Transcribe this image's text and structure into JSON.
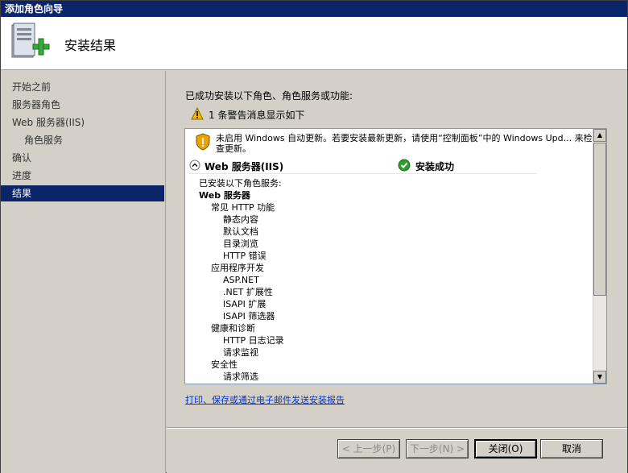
{
  "window": {
    "title": "添加角色向导"
  },
  "header": {
    "title": "安装结果",
    "icon": "server-add-icon"
  },
  "sidebar": {
    "items": [
      {
        "label": "开始之前",
        "active": false,
        "sub": false
      },
      {
        "label": "服务器角色",
        "active": false,
        "sub": false
      },
      {
        "label": "Web 服务器(IIS)",
        "active": false,
        "sub": false
      },
      {
        "label": "角色服务",
        "active": false,
        "sub": true
      },
      {
        "label": "确认",
        "active": false,
        "sub": false
      },
      {
        "label": "进度",
        "active": false,
        "sub": false
      },
      {
        "label": "结果",
        "active": true,
        "sub": false
      }
    ]
  },
  "main": {
    "intro": "已成功安装以下角色、角色服务或功能:",
    "warning_summary": "1 条警告消息显示如下",
    "report": {
      "windows_update_warning": "未启用 Windows 自动更新。若要安装最新更新，请使用“控制面板”中的 Windows Upd... 来检查更新。",
      "role_name": "Web 服务器(IIS)",
      "role_status": "安装成功",
      "tree": [
        {
          "label": "已安装以下角色服务:",
          "level": 1,
          "bold": false
        },
        {
          "label": "Web 服务器",
          "level": 1,
          "bold": true
        },
        {
          "label": "常见 HTTP 功能",
          "level": 2,
          "bold": false
        },
        {
          "label": "静态内容",
          "level": 3,
          "bold": false
        },
        {
          "label": "默认文档",
          "level": 3,
          "bold": false
        },
        {
          "label": "目录浏览",
          "level": 3,
          "bold": false
        },
        {
          "label": "HTTP 错误",
          "level": 3,
          "bold": false
        },
        {
          "label": "应用程序开发",
          "level": 2,
          "bold": false
        },
        {
          "label": "ASP.NET",
          "level": 3,
          "bold": false
        },
        {
          "label": ".NET 扩展性",
          "level": 3,
          "bold": false
        },
        {
          "label": "ISAPI 扩展",
          "level": 3,
          "bold": false
        },
        {
          "label": "ISAPI 筛选器",
          "level": 3,
          "bold": false
        },
        {
          "label": "健康和诊断",
          "level": 2,
          "bold": false
        },
        {
          "label": "HTTP 日志记录",
          "level": 3,
          "bold": false
        },
        {
          "label": "请求监视",
          "level": 3,
          "bold": false
        },
        {
          "label": "安全性",
          "level": 2,
          "bold": false
        },
        {
          "label": "请求筛选",
          "level": 3,
          "bold": false
        }
      ]
    },
    "print_link": "打印、保存或通过电子邮件发送安装报告"
  },
  "buttons": {
    "prev": "< 上一步(P)",
    "next": "下一步(N) >",
    "close": "关闭(O)",
    "cancel": "取消"
  },
  "colors": {
    "titlebar": "#0b246a",
    "active_nav": "#0b246a",
    "link": "#0033cc",
    "success": "#2e9e2e",
    "warning": "#f2b705"
  }
}
